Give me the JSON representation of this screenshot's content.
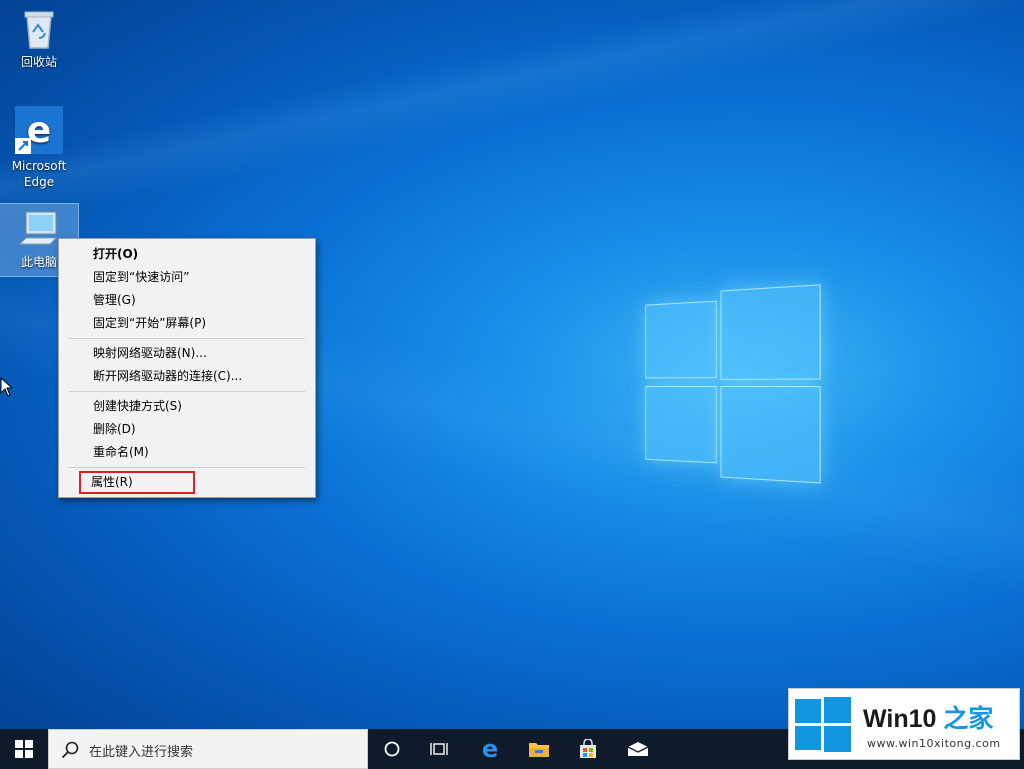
{
  "desktop": {
    "icons": [
      {
        "label": "回收站"
      },
      {
        "label": "Microsoft Edge"
      },
      {
        "label": "此电脑"
      }
    ]
  },
  "context_menu": {
    "items": [
      {
        "label": "打开(O)"
      },
      {
        "label": "固定到“快速访问”"
      },
      {
        "label": "管理(G)"
      },
      {
        "label": "固定到“开始”屏幕(P)"
      },
      {
        "label": "映射网络驱动器(N)..."
      },
      {
        "label": "断开网络驱动器的连接(C)..."
      },
      {
        "label": "创建快捷方式(S)"
      },
      {
        "label": "删除(D)"
      },
      {
        "label": "重命名(M)"
      },
      {
        "label": "属性(R)"
      }
    ]
  },
  "taskbar": {
    "search_placeholder": "在此键入进行搜索"
  },
  "watermark": {
    "brand": "Win10",
    "brand_cn": "之家",
    "url": "www.win10xitong.com"
  },
  "colors": {
    "highlight_box": "#e02020",
    "accent": "#1396e0",
    "taskbar": "#0f1b2b"
  }
}
